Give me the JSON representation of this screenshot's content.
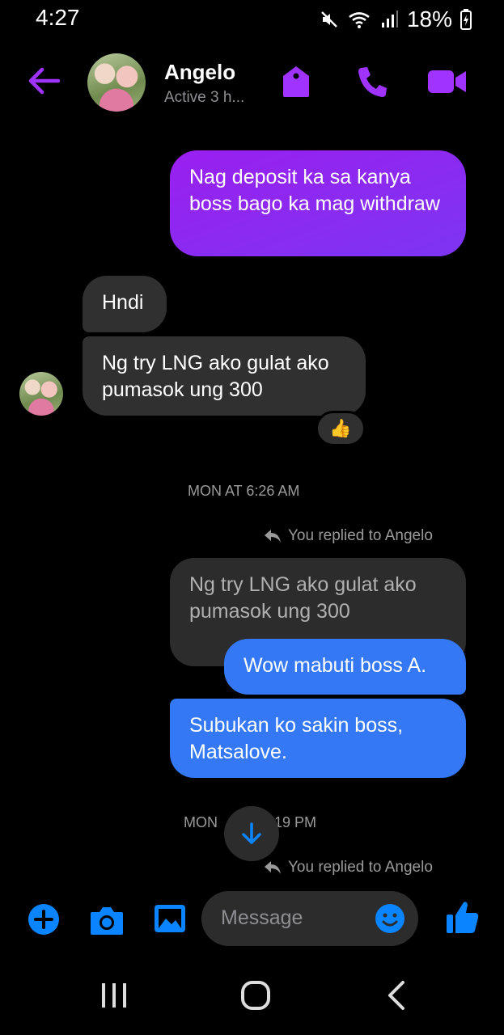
{
  "status_bar": {
    "time": "4:27",
    "battery": "18%"
  },
  "header": {
    "contact_name": "Angelo",
    "contact_status": "Active 3 h...",
    "icons": [
      "back-arrow-icon",
      "tag-icon",
      "phone-icon",
      "video-camera-icon"
    ]
  },
  "messages": [
    {
      "sender": "me",
      "text": "Nag deposit ka sa kanya boss bago ka mag withdraw"
    },
    {
      "sender": "Angelo",
      "text": "Hndi"
    },
    {
      "sender": "Angelo",
      "text": "Ng try LNG ako gulat ako pumasok ung 300",
      "reaction": "👍"
    },
    {
      "sender": "me",
      "reply_to": "Ng try LNG ako gulat ako pumasok ung 300",
      "text": "Wow mabuti boss A."
    },
    {
      "sender": "me",
      "text": "Subukan ko sakin boss, Matsalove."
    }
  ],
  "timestamps": [
    "MON AT 6:26 AM",
    "MON",
    "19 PM"
  ],
  "reply_notes": [
    "You replied to Angelo",
    "You replied to Angelo"
  ],
  "composer": {
    "placeholder": "Message"
  },
  "colors": {
    "accent": "#a033ff",
    "blue": "#0a84ff",
    "bubble_blue": "#3478f6",
    "bubble_gray": "#303030"
  }
}
